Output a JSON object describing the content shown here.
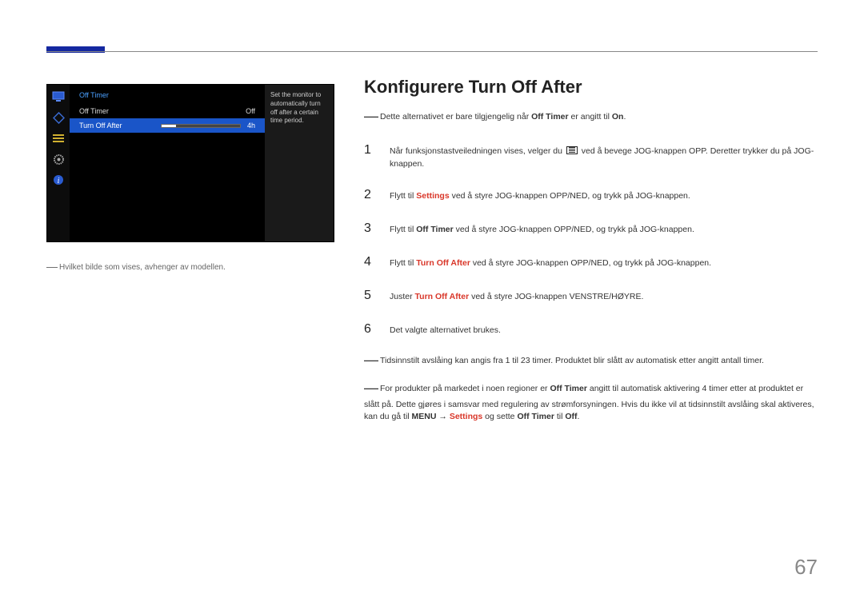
{
  "osd": {
    "title": "Off Timer",
    "rows": [
      {
        "label": "Off Timer",
        "value": "Off"
      },
      {
        "label": "Turn Off After",
        "value": "4h"
      }
    ],
    "help": "Set the monitor to automatically turn off after a certain time period."
  },
  "caption": "Hvilket bilde som vises, avhenger av modellen.",
  "heading": "Konfigurere Turn Off After",
  "intro_note": {
    "pre": "Dette alternativet er bare tilgjengelig når ",
    "bold1": "Off Timer",
    "mid": " er angitt til ",
    "bold2": "On",
    "post": "."
  },
  "steps": {
    "s1": {
      "pre": "Når funksjonstastveiledningen vises, velger du ",
      "post": " ved å bevege JOG-knappen OPP. Deretter trykker du på JOG-knappen."
    },
    "s2": {
      "pre": "Flytt til ",
      "red": "Settings",
      "post": " ved å styre JOG-knappen OPP/NED, og trykk på JOG-knappen."
    },
    "s3": {
      "pre": "Flytt til ",
      "bold": "Off Timer",
      "post": " ved å styre JOG-knappen OPP/NED, og trykk på JOG-knappen."
    },
    "s4": {
      "pre": "Flytt til ",
      "red": "Turn Off After",
      "post": " ved å styre JOG-knappen OPP/NED, og trykk på JOG-knappen."
    },
    "s5": {
      "pre": "Juster ",
      "red": "Turn Off After",
      "post": " ved å styre JOG-knappen VENSTRE/HØYRE."
    },
    "s6": "Det valgte alternativet brukes."
  },
  "footnote1": "Tidsinnstilt avslåing kan angis fra 1 til 23 timer. Produktet blir slått av automatisk etter angitt antall timer.",
  "footnote2": {
    "pre": "For produkter på markedet i noen regioner er ",
    "bold1": "Off Timer",
    "mid1": " angitt til automatisk aktivering 4 timer etter at produktet er slått på. Dette gjøres i samsvar med regulering av strømforsyningen. Hvis du ikke vil at tidsinnstilt avslåing skal aktiveres, kan du gå til ",
    "bold2": "MENU",
    "arrow": " → ",
    "red1": "Settings",
    "mid2": " og sette ",
    "bold3": "Off Timer",
    "mid3": " til ",
    "bold4": "Off",
    "post": "."
  },
  "page": "67"
}
